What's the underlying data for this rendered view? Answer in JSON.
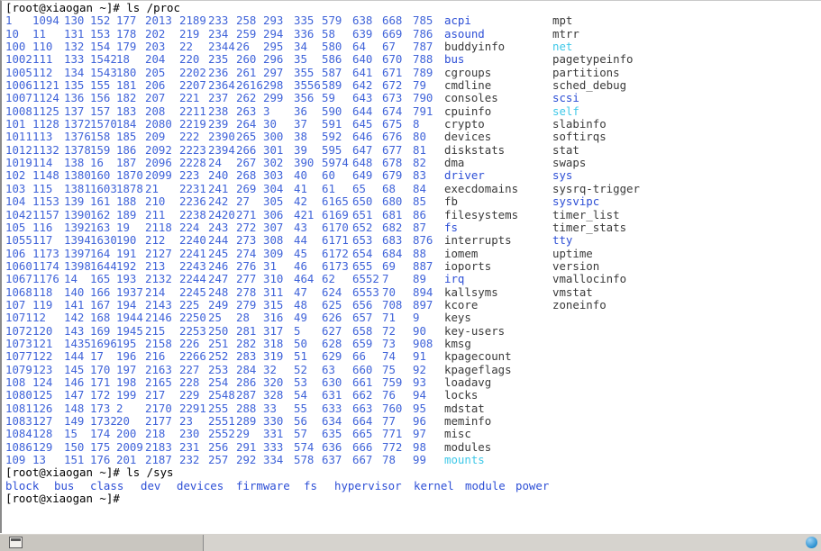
{
  "window": {
    "title": "root@xiaogan:~",
    "shell_user_host": "root@xiaogan"
  },
  "colors": {
    "background": "#ffffff",
    "directory": "#2d4fd6",
    "file": "#3a3a3a",
    "symlink": "#3ec8e8",
    "number_dir": "#3f63d9",
    "prompt_text": "#000000",
    "taskbar": "#d6d3ce"
  },
  "session": {
    "prompt1": "[root@xiaogan ~]# ls /proc",
    "prompt2": "[root@xiaogan ~]# ls /sys",
    "prompt3": "[root@xiaogan ~]#",
    "command1": "ls /proc",
    "command2": "ls /sys"
  },
  "proc_listing": {
    "columns": 17,
    "rows": 37,
    "grid": [
      [
        "1",
        "1094",
        "130",
        "152",
        "177",
        "2013",
        "2189",
        "233",
        "258",
        "293",
        "335",
        "579",
        "638",
        "668",
        "785",
        "acpi",
        "mpt"
      ],
      [
        "10",
        "11",
        "131",
        "153",
        "178",
        "202",
        "219",
        "234",
        "259",
        "294",
        "336",
        "58",
        "639",
        "669",
        "786",
        "asound",
        "mtrr"
      ],
      [
        "100",
        "110",
        "132",
        "154",
        "179",
        "203",
        "22",
        "2344",
        "26",
        "295",
        "34",
        "580",
        "64",
        "67",
        "787",
        "buddyinfo",
        "net"
      ],
      [
        "1002",
        "111",
        "133",
        "1542",
        "18",
        "204",
        "220",
        "235",
        "260",
        "296",
        "35",
        "586",
        "640",
        "670",
        "788",
        "bus",
        "pagetypeinfo"
      ],
      [
        "1005",
        "112",
        "134",
        "1543",
        "180",
        "205",
        "2202",
        "236",
        "261",
        "297",
        "355",
        "587",
        "641",
        "671",
        "789",
        "cgroups",
        "partitions"
      ],
      [
        "1006",
        "1121",
        "135",
        "155",
        "181",
        "206",
        "2207",
        "2364",
        "2616",
        "298",
        "3556",
        "589",
        "642",
        "672",
        "79",
        "cmdline",
        "sched_debug"
      ],
      [
        "1007",
        "1124",
        "136",
        "156",
        "182",
        "207",
        "221",
        "237",
        "262",
        "299",
        "356",
        "59",
        "643",
        "673",
        "790",
        "consoles",
        "scsi"
      ],
      [
        "1008",
        "1125",
        "137",
        "157",
        "183",
        "208",
        "2211",
        "238",
        "263",
        "3",
        "36",
        "590",
        "644",
        "674",
        "791",
        "cpuinfo",
        "self"
      ],
      [
        "101",
        "1128",
        "1372",
        "1570",
        "184",
        "2080",
        "2219",
        "239",
        "264",
        "30",
        "37",
        "591",
        "645",
        "675",
        "8",
        "crypto",
        "slabinfo"
      ],
      [
        "1011",
        "113",
        "1376",
        "158",
        "185",
        "209",
        "222",
        "2390",
        "265",
        "300",
        "38",
        "592",
        "646",
        "676",
        "80",
        "devices",
        "softirqs"
      ],
      [
        "1012",
        "1132",
        "1378",
        "159",
        "186",
        "2092",
        "2223",
        "2394",
        "266",
        "301",
        "39",
        "595",
        "647",
        "677",
        "81",
        "diskstats",
        "stat"
      ],
      [
        "1019",
        "114",
        "138",
        "16",
        "187",
        "2096",
        "2228",
        "24",
        "267",
        "302",
        "390",
        "5974",
        "648",
        "678",
        "82",
        "dma",
        "swaps"
      ],
      [
        "102",
        "1148",
        "1380",
        "160",
        "1870",
        "2099",
        "223",
        "240",
        "268",
        "303",
        "40",
        "60",
        "649",
        "679",
        "83",
        "driver",
        "sys"
      ],
      [
        "103",
        "115",
        "1381",
        "1603",
        "1878",
        "21",
        "2231",
        "241",
        "269",
        "304",
        "41",
        "61",
        "65",
        "68",
        "84",
        "execdomains",
        "sysrq-trigger"
      ],
      [
        "104",
        "1153",
        "139",
        "161",
        "188",
        "210",
        "2236",
        "242",
        "27",
        "305",
        "42",
        "6165",
        "650",
        "680",
        "85",
        "fb",
        "sysvipc"
      ],
      [
        "1042",
        "1157",
        "1390",
        "162",
        "189",
        "211",
        "2238",
        "2420",
        "271",
        "306",
        "421",
        "6169",
        "651",
        "681",
        "86",
        "filesystems",
        "timer_list"
      ],
      [
        "105",
        "116",
        "1392",
        "163",
        "19",
        "2118",
        "224",
        "243",
        "272",
        "307",
        "43",
        "6170",
        "652",
        "682",
        "87",
        "fs",
        "timer_stats"
      ],
      [
        "1055",
        "117",
        "1394",
        "1630",
        "190",
        "212",
        "2240",
        "244",
        "273",
        "308",
        "44",
        "6171",
        "653",
        "683",
        "876",
        "interrupts",
        "tty"
      ],
      [
        "106",
        "1173",
        "1397",
        "164",
        "191",
        "2127",
        "2241",
        "245",
        "274",
        "309",
        "45",
        "6172",
        "654",
        "684",
        "88",
        "iomem",
        "uptime"
      ],
      [
        "1060",
        "1174",
        "1398",
        "1644",
        "192",
        "213",
        "2243",
        "246",
        "276",
        "31",
        "46",
        "6173",
        "655",
        "69",
        "887",
        "ioports",
        "version"
      ],
      [
        "1067",
        "1176",
        "14",
        "165",
        "193",
        "2132",
        "2244",
        "247",
        "277",
        "310",
        "464",
        "62",
        "6552",
        "7",
        "89",
        "irq",
        "vmallocinfo"
      ],
      [
        "1068",
        "118",
        "140",
        "166",
        "1937",
        "214",
        "2245",
        "248",
        "278",
        "311",
        "47",
        "624",
        "6553",
        "70",
        "894",
        "kallsyms",
        "vmstat"
      ],
      [
        "107",
        "119",
        "141",
        "167",
        "194",
        "2143",
        "225",
        "249",
        "279",
        "315",
        "48",
        "625",
        "656",
        "708",
        "897",
        "kcore",
        "zoneinfo"
      ],
      [
        "1071",
        "12",
        "142",
        "168",
        "1944",
        "2146",
        "2250",
        "25",
        "28",
        "316",
        "49",
        "626",
        "657",
        "71",
        "9",
        "keys",
        ""
      ],
      [
        "1072",
        "120",
        "143",
        "169",
        "1945",
        "215",
        "2253",
        "250",
        "281",
        "317",
        "5",
        "627",
        "658",
        "72",
        "90",
        "key-users",
        ""
      ],
      [
        "1073",
        "121",
        "1435",
        "1696",
        "195",
        "2158",
        "226",
        "251",
        "282",
        "318",
        "50",
        "628",
        "659",
        "73",
        "908",
        "kmsg",
        ""
      ],
      [
        "1077",
        "122",
        "144",
        "17",
        "196",
        "216",
        "2266",
        "252",
        "283",
        "319",
        "51",
        "629",
        "66",
        "74",
        "91",
        "kpagecount",
        ""
      ],
      [
        "1079",
        "123",
        "145",
        "170",
        "197",
        "2163",
        "227",
        "253",
        "284",
        "32",
        "52",
        "63",
        "660",
        "75",
        "92",
        "kpageflags",
        ""
      ],
      [
        "108",
        "124",
        "146",
        "171",
        "198",
        "2165",
        "228",
        "254",
        "286",
        "320",
        "53",
        "630",
        "661",
        "759",
        "93",
        "loadavg",
        ""
      ],
      [
        "1080",
        "125",
        "147",
        "172",
        "199",
        "217",
        "229",
        "2548",
        "287",
        "328",
        "54",
        "631",
        "662",
        "76",
        "94",
        "locks",
        ""
      ],
      [
        "1081",
        "126",
        "148",
        "173",
        "2",
        "2170",
        "2291",
        "255",
        "288",
        "33",
        "55",
        "633",
        "663",
        "760",
        "95",
        "mdstat",
        ""
      ],
      [
        "1083",
        "127",
        "149",
        "1732",
        "20",
        "2177",
        "23",
        "2551",
        "289",
        "330",
        "56",
        "634",
        "664",
        "77",
        "96",
        "meminfo",
        ""
      ],
      [
        "1084",
        "128",
        "15",
        "174",
        "200",
        "218",
        "230",
        "2552",
        "29",
        "331",
        "57",
        "635",
        "665",
        "771",
        "97",
        "misc",
        ""
      ],
      [
        "1086",
        "129",
        "150",
        "175",
        "2009",
        "2183",
        "231",
        "256",
        "291",
        "333",
        "574",
        "636",
        "666",
        "772",
        "98",
        "modules",
        ""
      ],
      [
        "109",
        "13",
        "151",
        "176",
        "201",
        "2187",
        "232",
        "257",
        "292",
        "334",
        "578",
        "637",
        "667",
        "78",
        "99",
        "mounts",
        ""
      ]
    ],
    "name_types_col16": {
      "acpi": "dir",
      "asound": "dir",
      "buddyinfo": "file",
      "bus": "dir",
      "cgroups": "file",
      "cmdline": "file",
      "consoles": "file",
      "cpuinfo": "file",
      "crypto": "file",
      "devices": "file",
      "diskstats": "file",
      "dma": "file",
      "driver": "dir",
      "execdomains": "file",
      "fb": "file",
      "filesystems": "file",
      "fs": "dir",
      "interrupts": "file",
      "iomem": "file",
      "ioports": "file",
      "irq": "dir",
      "kallsyms": "file",
      "kcore": "file",
      "keys": "file",
      "key-users": "file",
      "kmsg": "file",
      "kpagecount": "file",
      "kpageflags": "file",
      "loadavg": "file",
      "locks": "file",
      "mdstat": "file",
      "meminfo": "file",
      "misc": "file",
      "modules": "file",
      "mounts": "link"
    },
    "name_types_col17": {
      "mpt": "file",
      "mtrr": "file",
      "net": "link",
      "pagetypeinfo": "file",
      "partitions": "file",
      "sched_debug": "file",
      "scsi": "dir",
      "self": "link",
      "slabinfo": "file",
      "softirqs": "file",
      "stat": "file",
      "swaps": "file",
      "sys": "dir",
      "sysrq-trigger": "file",
      "sysvipc": "dir",
      "timer_list": "file",
      "timer_stats": "file",
      "tty": "dir",
      "uptime": "file",
      "version": "file",
      "vmallocinfo": "file",
      "vmstat": "file",
      "zoneinfo": "file"
    }
  },
  "sys_listing": {
    "entries": [
      "block",
      "bus",
      "class",
      "dev",
      "devices",
      "firmware",
      "fs",
      "hypervisor",
      "kernel",
      "module",
      "power"
    ],
    "type": "dir"
  },
  "taskbar": {
    "left_icon": "terminal-icon",
    "tray_text": "",
    "tray_icon": "globe-icon"
  }
}
